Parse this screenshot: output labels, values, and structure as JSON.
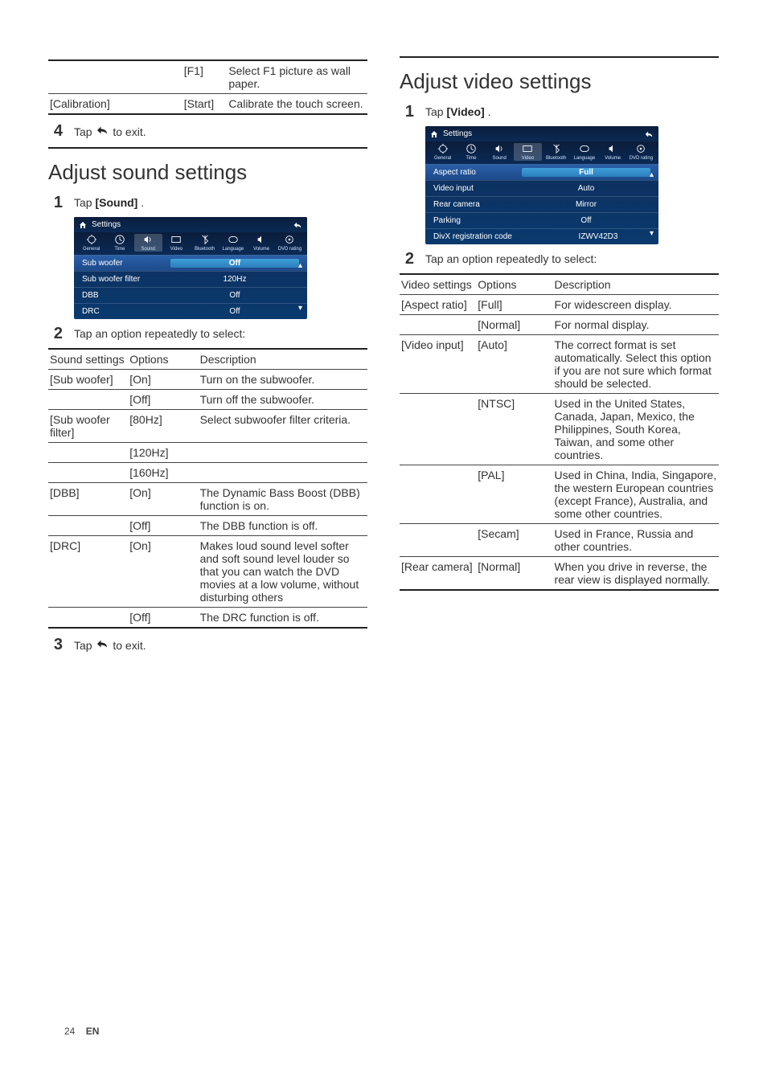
{
  "footer": {
    "page": "24",
    "lang": "EN"
  },
  "col1": {
    "topTable": [
      {
        "c1": "",
        "c2": "[F1]",
        "c3": "Select F1 picture as wall paper."
      },
      {
        "c1": "[Calibration]",
        "c2": "[Start]",
        "c3": "Calibrate the touch screen."
      }
    ],
    "step4": {
      "n": "4",
      "pre": "Tap ",
      "post": " to exit."
    },
    "h2_sound": "Adjust sound settings",
    "step1s": {
      "n": "1",
      "pre": "Tap ",
      "bold": "[Sound]",
      "post": "."
    },
    "ui_sound": {
      "title": "Settings",
      "tabs": [
        "General",
        "Time",
        "Sound",
        "Video",
        "Bluetooth",
        "Language",
        "Volume",
        "DVD rating"
      ],
      "rows": [
        {
          "label": "Sub woofer",
          "val": "Off",
          "sel": true
        },
        {
          "label": "Sub woofer filter",
          "val": "120Hz"
        },
        {
          "label": "DBB",
          "val": "Off"
        },
        {
          "label": "DRC",
          "val": "Off"
        }
      ]
    },
    "step2s": {
      "n": "2",
      "text": "Tap an option repeatedly to select:"
    },
    "soundTableHeader": {
      "c1": "Sound settings",
      "c2": "Options",
      "c3": "Description"
    },
    "soundTable": [
      {
        "c1": "[Sub woofer]",
        "c2": "[On]",
        "c3": "Turn on the subwoofer."
      },
      {
        "c1": "",
        "c2": "[Off]",
        "c3": "Turn off the subwoofer."
      },
      {
        "c1": "[Sub woofer filter]",
        "c2": "[80Hz]",
        "c3": "Select subwoofer filter criteria."
      },
      {
        "c1": "",
        "c2": "[120Hz]",
        "c3": ""
      },
      {
        "c1": "",
        "c2": "[160Hz]",
        "c3": ""
      },
      {
        "c1": "[DBB]",
        "c2": "[On]",
        "c3": "The Dynamic Bass Boost (DBB) function is on."
      },
      {
        "c1": "",
        "c2": "[Off]",
        "c3": "The DBB function is off."
      },
      {
        "c1": "[DRC]",
        "c2": "[On]",
        "c3": "Makes loud sound level softer and soft sound level louder so that you can watch the DVD movies at a low volume, without disturbing others"
      },
      {
        "c1": "",
        "c2": "[Off]",
        "c3": "The DRC function is off."
      }
    ],
    "step3s": {
      "n": "3",
      "pre": "Tap ",
      "post": " to exit."
    }
  },
  "col2": {
    "h2_video": "Adjust video settings",
    "step1v": {
      "n": "1",
      "pre": "Tap ",
      "bold": "[Video]",
      "post": "."
    },
    "ui_video": {
      "title": "Settings",
      "tabs": [
        "General",
        "Time",
        "Sound",
        "Video",
        "Bluetooth",
        "Language",
        "Volume",
        "DVD rating"
      ],
      "rows": [
        {
          "label": "Aspect ratio",
          "val": "Full",
          "sel": true
        },
        {
          "label": "Video input",
          "val": "Auto"
        },
        {
          "label": "Rear camera",
          "val": "Mirror"
        },
        {
          "label": "Parking",
          "val": "Off"
        },
        {
          "label": "DivX registration code",
          "val": "IZWV42D3"
        }
      ]
    },
    "step2v": {
      "n": "2",
      "text": "Tap an option repeatedly to select:"
    },
    "videoTableHeader": {
      "c1": "Video settings",
      "c2": "Options",
      "c3": "Description"
    },
    "videoTable": [
      {
        "c1": "[Aspect ratio]",
        "c2": "[Full]",
        "c3": "For widescreen display."
      },
      {
        "c1": "",
        "c2": "[Normal]",
        "c3": "For normal display."
      },
      {
        "c1": "[Video input]",
        "c2": "[Auto]",
        "c3": "The correct format is set automatically. Select this option if you are not sure which format should be selected."
      },
      {
        "c1": "",
        "c2": "[NTSC]",
        "c3": "Used in the United States, Canada, Japan, Mexico, the Philippines, South Korea, Taiwan, and some other countries."
      },
      {
        "c1": "",
        "c2": "[PAL]",
        "c3": "Used in China, India, Singapore, the western European countries (except France), Australia, and some other countries."
      },
      {
        "c1": "",
        "c2": "[Secam]",
        "c3": "Used in France, Russia and other countries."
      },
      {
        "c1": "[Rear camera]",
        "c2": "[Normal]",
        "c3": "When you drive in reverse, the rear view is displayed normally."
      }
    ]
  }
}
